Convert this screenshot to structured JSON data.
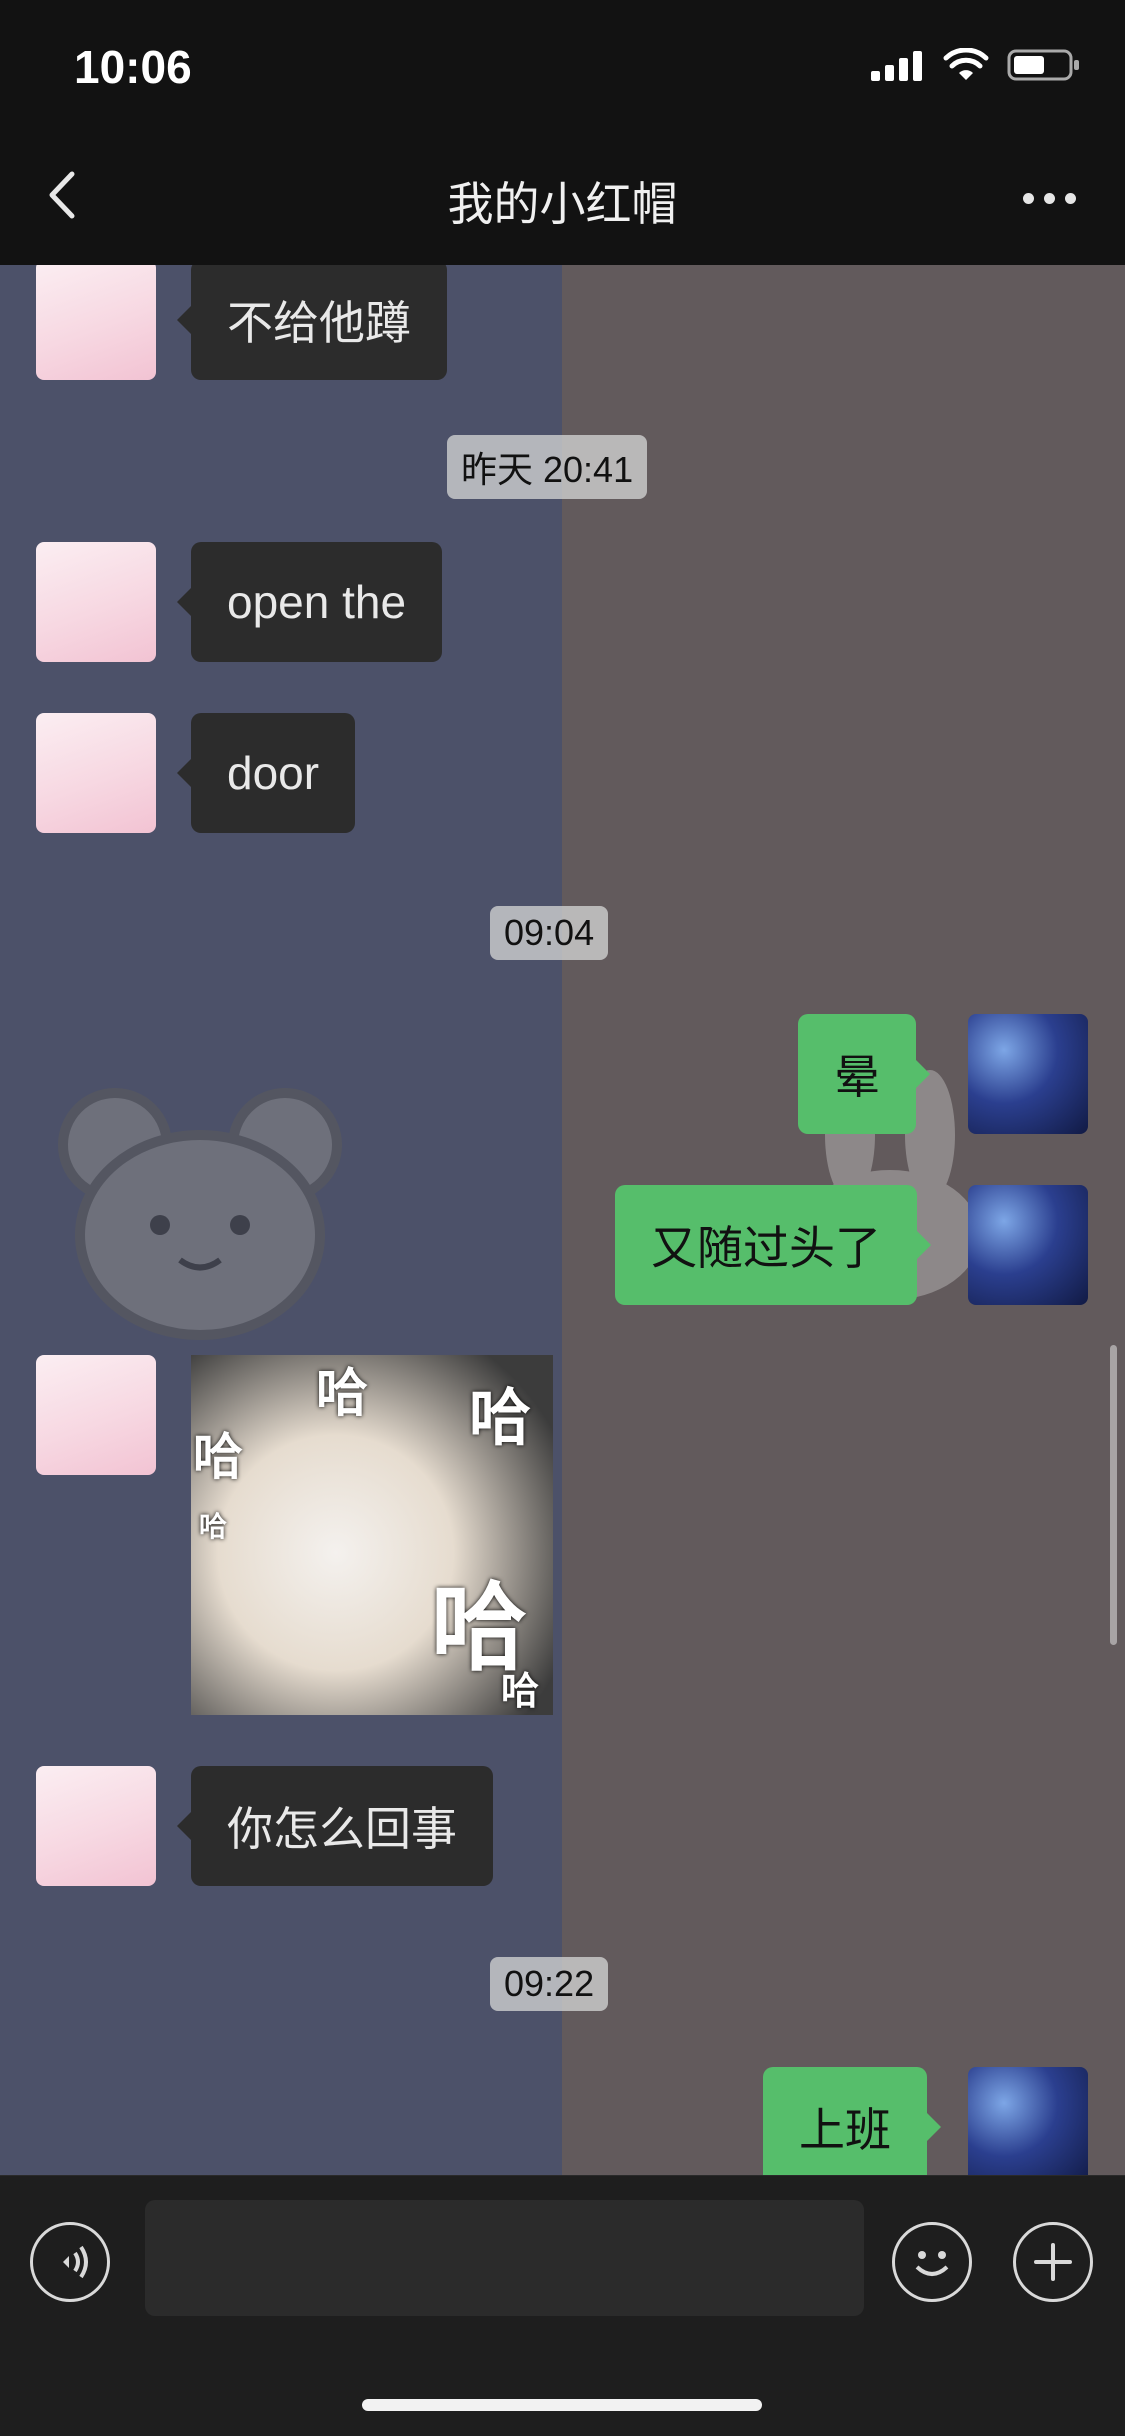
{
  "status_bar": {
    "time": "10:06"
  },
  "nav": {
    "title": "我的小红帽"
  },
  "messages": [
    {
      "side": "left",
      "text": "不给他蹲"
    },
    {
      "timestamp": "昨天 20:41"
    },
    {
      "side": "left",
      "text": "open the"
    },
    {
      "side": "left",
      "text": "door"
    },
    {
      "timestamp": "09:04"
    },
    {
      "side": "right",
      "text": "晕"
    },
    {
      "side": "right",
      "text": "又随过头了"
    },
    {
      "side": "left",
      "sticker_text": [
        "哈",
        "哈",
        "哈",
        "哈",
        "哈",
        "哈"
      ]
    },
    {
      "side": "left",
      "text": "你怎么回事"
    },
    {
      "timestamp": "09:22"
    },
    {
      "side": "right",
      "text": "上班"
    }
  ],
  "colors": {
    "left_bubble": "#2c2c2c",
    "right_bubble": "#56be6b",
    "chat_bg_left": "#4c5169",
    "chat_bg_right": "#625a5c"
  },
  "input_bar": {
    "voice_icon": "voice-icon",
    "emoji_icon": "emoji-icon",
    "plus_icon": "plus-icon"
  }
}
